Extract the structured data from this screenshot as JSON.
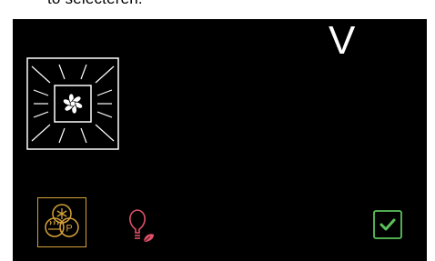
{
  "header": {
    "caption": "to selecteren."
  },
  "display": {
    "mode_letter": "V",
    "oven_icon": "oven-fan-icon",
    "buttons": {
      "eco_program": "eco-snowflake-program-icon",
      "light": "bulb-leaf-icon",
      "confirm": "checkbox-confirm-icon"
    },
    "colors": {
      "background": "#000000",
      "foreground": "#ffffff",
      "eco_accent": "#d4a03a",
      "light_accent": "#e0506a",
      "confirm_accent": "#5cc25c"
    }
  }
}
